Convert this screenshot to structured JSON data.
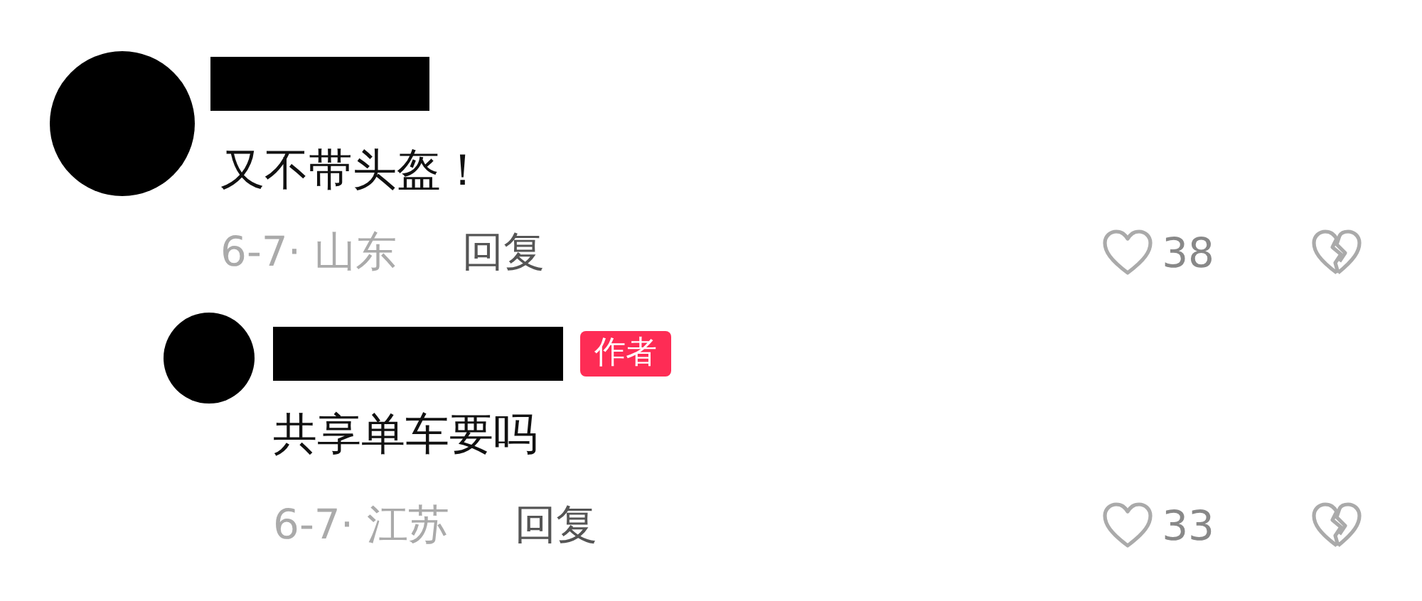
{
  "comments": [
    {
      "text": "又不带头盔！",
      "meta": "6-7· 山东",
      "reply_label": "回复",
      "likes": "38",
      "replies": [
        {
          "text": "共享单车要吗",
          "meta": "6-7· 江苏",
          "reply_label": "回复",
          "likes": "33",
          "badge": "作者"
        }
      ]
    }
  ]
}
